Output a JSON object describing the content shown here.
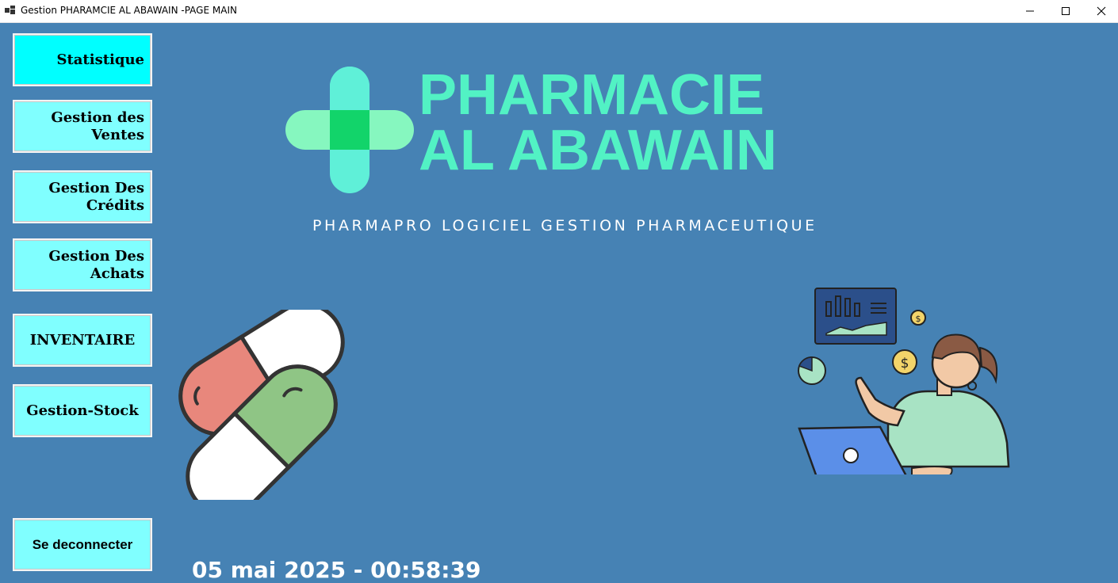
{
  "window": {
    "title": "Gestion PHARAMCIE AL ABAWAIN -PAGE MAIN",
    "minimize_icon": "minimize-icon",
    "maximize_icon": "maximize-icon",
    "close_icon": "close-icon"
  },
  "sidebar": {
    "items": [
      {
        "label": "Statistique",
        "active": true
      },
      {
        "label": "Gestion des Ventes"
      },
      {
        "label": "Gestion Des Crédits"
      },
      {
        "label": "Gestion Des Achats"
      },
      {
        "label": "INVENTAIRE"
      },
      {
        "label": "Gestion-Stock"
      }
    ],
    "logout_label": "Se deconnecter"
  },
  "brand": {
    "line1": "PHARMACIE",
    "line2": "AL ABAWAIN",
    "tagline": "PHARMAPRO LOGICIEL GESTION PHARMACEUTIQUE",
    "logo": "medical-cross-icon"
  },
  "datetime": "05 mai 2025 - 00:58:39",
  "colors": {
    "background": "#4682b4",
    "button": "#80ffff",
    "button_active": "#00ffff",
    "brand": "#52f2c4"
  }
}
